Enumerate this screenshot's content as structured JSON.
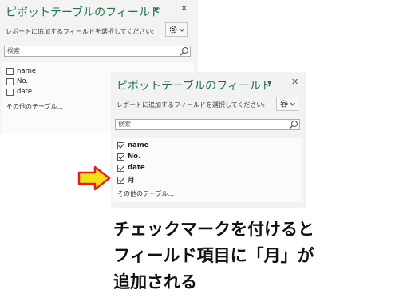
{
  "back_panel": {
    "title": "ピボットテーブルのフィールド",
    "dropdown_glyph": "▾",
    "close_glyph": "✕",
    "instruction": "レポートに追加するフィールドを選択してください:",
    "search": {
      "placeholder": "検索"
    },
    "fields": [
      {
        "label": "name",
        "checked": false
      },
      {
        "label": "No.",
        "checked": false
      },
      {
        "label": "date",
        "checked": false
      }
    ],
    "more_tables": "その他のテーブル..."
  },
  "front_panel": {
    "title": "ピボットテーブルのフィールド",
    "dropdown_glyph": "▾",
    "close_glyph": "✕",
    "instruction": "レポートに追加するフィールドを選択してください:",
    "search": {
      "placeholder": "検索"
    },
    "fields": [
      {
        "label": "name",
        "checked": true
      },
      {
        "label": "No.",
        "checked": true
      },
      {
        "label": "date",
        "checked": true
      },
      {
        "label": "月",
        "checked": true
      }
    ],
    "more_tables": "その他のテーブル..."
  },
  "callout": {
    "arrow_color": "#f4e01a",
    "arrow_border": "#e02020"
  },
  "caption": {
    "line1": "チェックマークを付けると",
    "line2": "フィールド項目に「月」が",
    "line3": "追加される"
  },
  "colors": {
    "title_green": "#217346",
    "panel_bg": "#f3f3f3"
  }
}
